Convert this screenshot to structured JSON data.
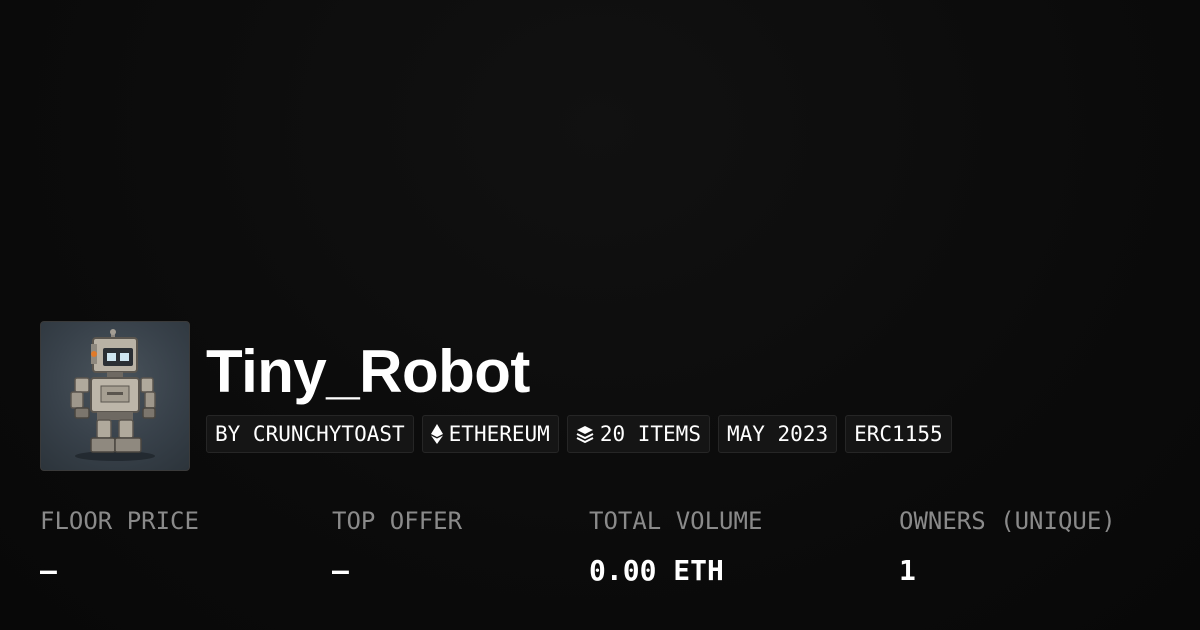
{
  "collection": {
    "name": "Tiny_Robot",
    "thumbnail_icon": "robot-avatar"
  },
  "tags": [
    {
      "label": "BY CRUNCHYTOAST",
      "icon": null
    },
    {
      "label": "ETHEREUM",
      "icon": "ethereum-icon"
    },
    {
      "label": "20 ITEMS",
      "icon": "stack-layers-icon"
    },
    {
      "label": "MAY 2023",
      "icon": null
    },
    {
      "label": "ERC1155",
      "icon": null
    }
  ],
  "stats": [
    {
      "label": "FLOOR PRICE",
      "value": "–"
    },
    {
      "label": "TOP OFFER",
      "value": "–"
    },
    {
      "label": "TOTAL VOLUME",
      "value": "0.00 ETH"
    },
    {
      "label": "OWNERS (UNIQUE)",
      "value": "1"
    }
  ],
  "colors": {
    "background": "#0b0b0b",
    "tag_background": "#151515",
    "label_gray": "#8a8a8a",
    "text": "#ffffff"
  }
}
